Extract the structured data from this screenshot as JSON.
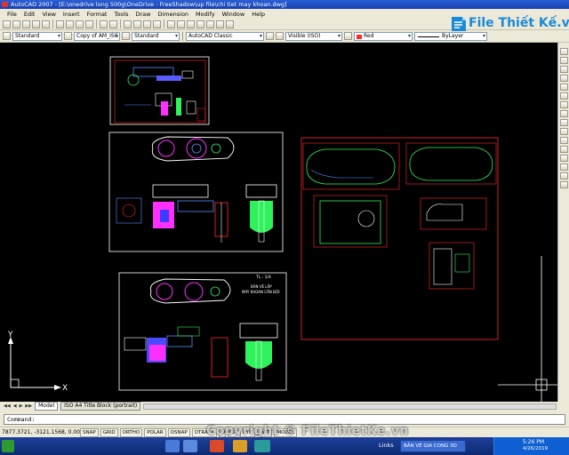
{
  "window": {
    "title": "AutoCAD 2007 - [E:\\onedrive long 500g\\OneDrive - FreeShadow\\up file\\chi tiet may khoan.dwg]"
  },
  "menu": [
    "File",
    "Edit",
    "View",
    "Insert",
    "Format",
    "Tools",
    "Draw",
    "Dimension",
    "Modify",
    "Window",
    "Help"
  ],
  "toolbar": {
    "text_style": "Standard",
    "dim_style": "Copy of AM_ISC",
    "table_style": "Standard",
    "workspace": "AutoCAD Classic",
    "layer_state": "Visible (ISO)",
    "color": "Red",
    "linetype": "ByLayer",
    "layer": "0"
  },
  "logo": {
    "text": "File Thiết Kế.vn"
  },
  "drawing": {
    "sheet3_label_1": "TL : 1/4",
    "sheet3_label_2": "BẢN VẼ LẮP",
    "sheet3_label_3": "MÁY KHOAN CẦN ĐỘI",
    "ucs_y": "Y",
    "ucs_x": "X"
  },
  "tabs": {
    "model": "Model",
    "layout": "ISO A4 Title Block (portrait)"
  },
  "command": {
    "prompt": "Command:"
  },
  "status": {
    "coords": "7877.3721, -3121.1568, 0.0000",
    "buttons": [
      "SNAP",
      "GRID",
      "ORTHO",
      "POLAR",
      "OSNAP",
      "OTRACK",
      "DUCS",
      "DYN",
      "LWT",
      "MODEL"
    ]
  },
  "taskbar": {
    "links": "Links",
    "task": "BẢN VẼ GIA CONG 3D",
    "time": "5:26 PM",
    "date": "4/26/2019"
  },
  "watermark": "Copyright © FileThietKe.vn",
  "colors": {
    "titlebar": "#1f4fc4",
    "chrome": "#ece9d8",
    "canvas": "#000000",
    "frame": "#ffffff",
    "red_layer": "#ff2a2a",
    "accent_cyan": "#1a8ad8"
  }
}
